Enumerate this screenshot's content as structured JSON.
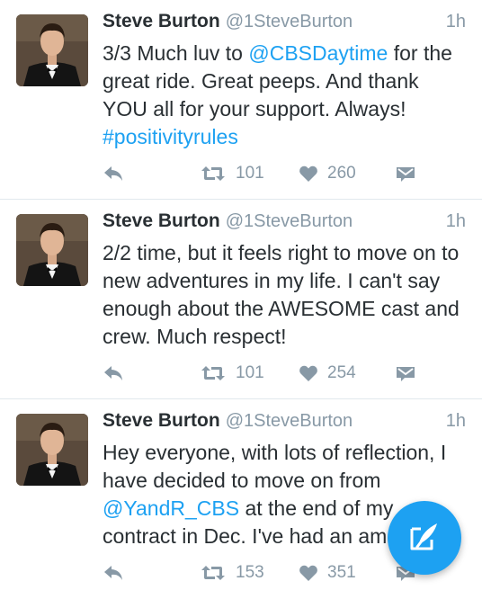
{
  "tweets": [
    {
      "name": "Steve Burton",
      "handle": "@1SteveBurton",
      "time": "1h",
      "text": [
        {
          "t": "3/3 Much luv to "
        },
        {
          "t": "@CBSDaytime",
          "link": true
        },
        {
          "t": " for the great ride. Great peeps. And thank YOU all for your support. Always! "
        },
        {
          "t": "#positivityrules",
          "link": true
        }
      ],
      "retweets": "101",
      "likes": "260"
    },
    {
      "name": "Steve Burton",
      "handle": "@1SteveBurton",
      "time": "1h",
      "text": [
        {
          "t": "2/2 time, but it feels right to move on to new adventures in my life. I can't say enough about the AWESOME cast and crew. Much respect!"
        }
      ],
      "retweets": "101",
      "likes": "254"
    },
    {
      "name": "Steve Burton",
      "handle": "@1SteveBurton",
      "time": "1h",
      "text": [
        {
          "t": "Hey everyone, with lots of reflection, I have decided to move on from "
        },
        {
          "t": "@YandR_CBS",
          "link": true
        },
        {
          "t": " at the end of my contract in Dec. I've had an am"
        }
      ],
      "retweets": "153",
      "likes": "351"
    }
  ],
  "icons": {
    "reply": "reply-icon",
    "retweet": "retweet-icon",
    "like": "heart-icon",
    "dm": "direct-message-icon",
    "compose": "compose-tweet-icon"
  },
  "colors": {
    "link": "#1da1f2",
    "muted": "#8899a6",
    "text": "#292f33",
    "fab": "#1da1f2"
  }
}
